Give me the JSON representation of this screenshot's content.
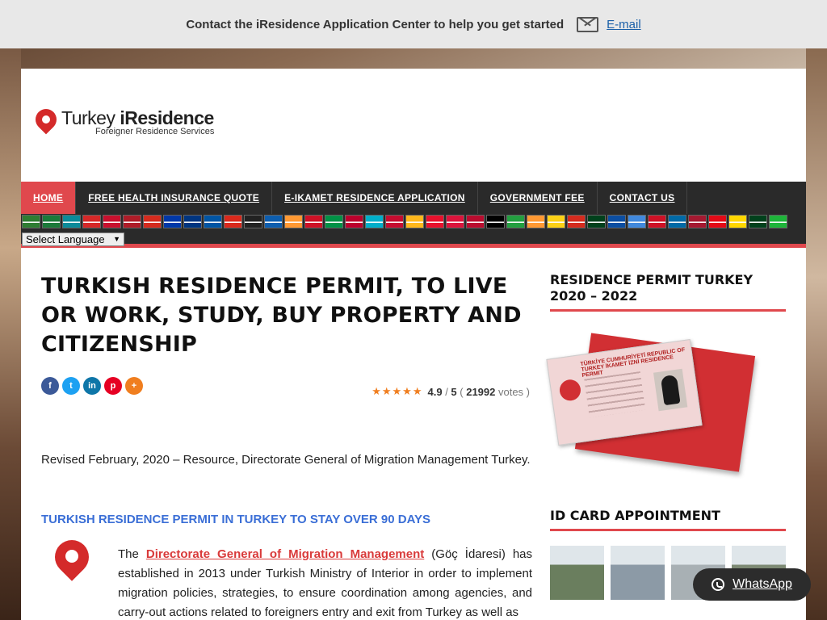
{
  "topbar": {
    "message": "Contact the iResidence Application Center to help you get started",
    "email_label": "E-mail"
  },
  "logo": {
    "line1_a": "Turkey ",
    "line1_b": "iResidence",
    "line2": "Foreigner Residence Services"
  },
  "nav": {
    "items": [
      {
        "label": "HOME"
      },
      {
        "label": "FREE HEALTH INSURANCE QUOTE"
      },
      {
        "label": "E-IKAMET RESIDENCE APPLICATION"
      },
      {
        "label": "GOVERNMENT FEE"
      },
      {
        "label": "CONTACT US"
      }
    ],
    "language_select": "Select Language"
  },
  "flags": [
    "#2e7d32",
    "#1b7a3a",
    "#0b8b9a",
    "#d62828",
    "#c8102e",
    "#ae1c28",
    "#d52b1e",
    "#0038a8",
    "#003580",
    "#0055a4",
    "#da291c",
    "#222",
    "#0d5eaf",
    "#ff9933",
    "#ce1126",
    "#009246",
    "#bc002d",
    "#00afca",
    "#c60c30",
    "#ffb81c",
    "#e8112d",
    "#dc143c",
    "#ba0c2f",
    "#000",
    "#239f40",
    "#ff9933",
    "#fcd116",
    "#d52b1e",
    "#01411c",
    "#0b4ea2",
    "#4189dd",
    "#ce1126",
    "#006aa7",
    "#a51931",
    "#e30a17",
    "#ffd700",
    "#01411c",
    "#1eb53a"
  ],
  "main": {
    "title": "TURKISH RESIDENCE PERMIT, TO LIVE OR WORK, STUDY, BUY PROPERTY AND CITIZENSHIP",
    "share": [
      {
        "icon": "facebook-icon",
        "glyph": "f",
        "color": "#3b5998"
      },
      {
        "icon": "twitter-icon",
        "glyph": "t",
        "color": "#1da1f2"
      },
      {
        "icon": "linkedin-icon",
        "glyph": "in",
        "color": "#0e76a8"
      },
      {
        "icon": "pinterest-icon",
        "glyph": "p",
        "color": "#e60023"
      },
      {
        "icon": "more-icon",
        "glyph": "+",
        "color": "#f07e1f"
      }
    ],
    "rating": {
      "stars": "★★★★★",
      "score": "4.9",
      "sep": " / ",
      "max": "5",
      "open": " ( ",
      "votes": "21992",
      "votes_label": " votes )"
    },
    "revised": "Revised February, 2020 – Resource, Directorate General of Migration Management Turkey.",
    "subhead": "TURKISH RESIDENCE PERMIT IN TURKEY TO STAY OVER 90 DAYS",
    "para_pre": "The ",
    "para_link": "Directorate General of Migration Management",
    "para_post": " (Göç İdaresi) has established in 2013 under Turkish Ministry of Interior in order to implement migration policies, strategies, to ensure coordination among agencies, and carry-out actions related to foreigners entry and exit from Turkey as well as"
  },
  "sidebar": {
    "widget1_title": "RESIDENCE PERMIT TURKEY 2020 – 2022",
    "card_text": "TÜRKİYE CUMHURİYETİ REPUBLIC OF TURKEY İKAMET İZNİ RESIDENCE PERMIT",
    "widget2_title": "ID CARD APPOINTMENT",
    "thumb_colors": [
      "#6a7e5e",
      "#8c9aa6",
      "#a8b0b4",
      "#7d8a74"
    ]
  },
  "whatsapp": {
    "label": "WhatsApp"
  }
}
